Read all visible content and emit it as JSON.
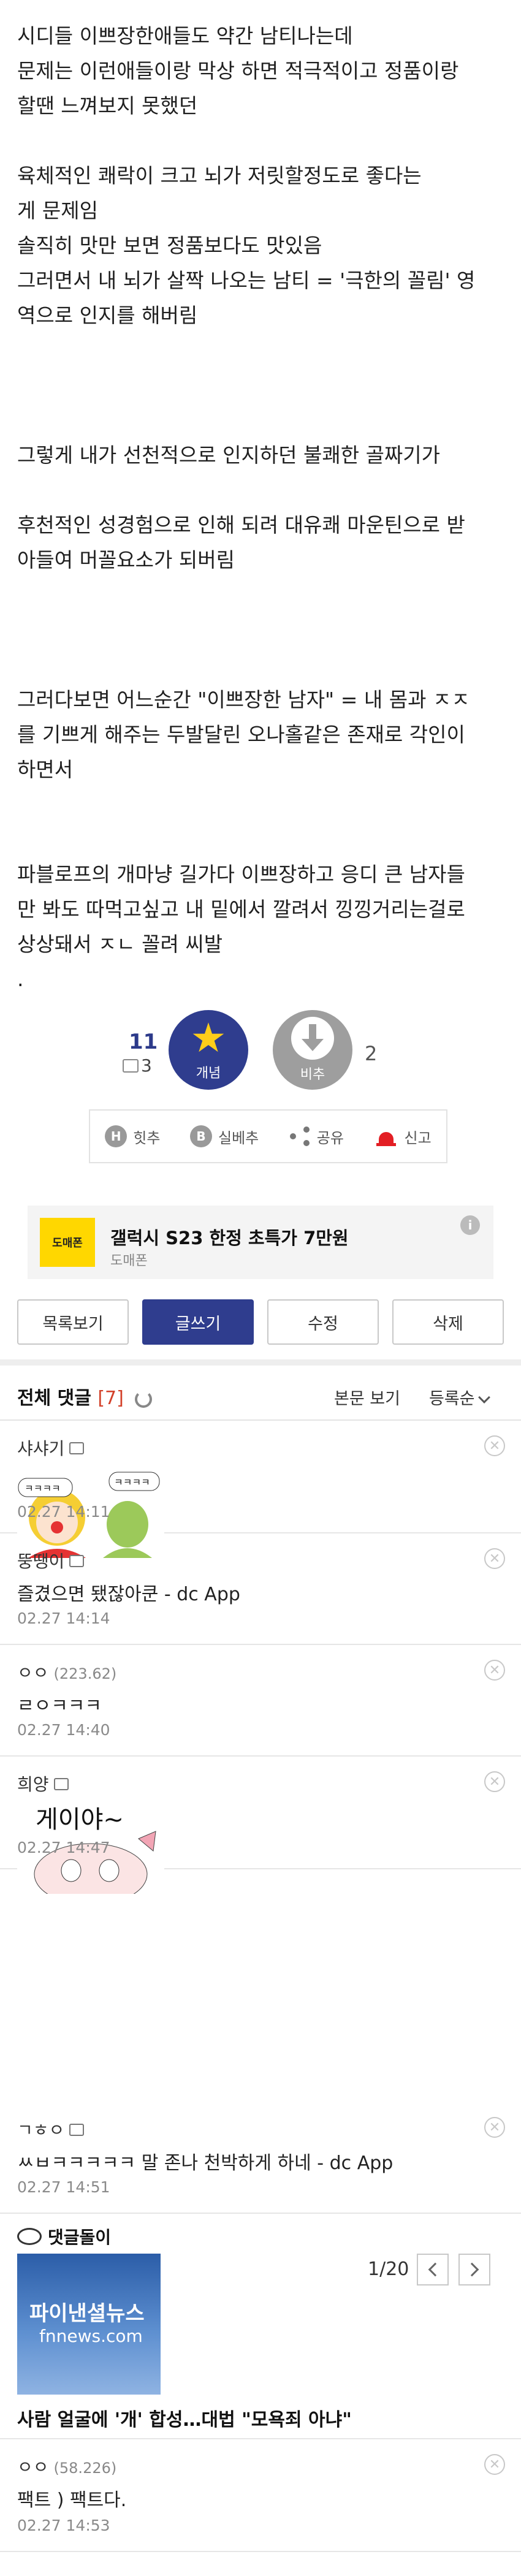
{
  "post": {
    "lines": [
      "시디들 이쁘장한애들도 약간 남티나는데",
      "문제는 이런애들이랑 막상 하면 적극적이고 정품이랑",
      "할땐 느껴보지 못했던",
      "",
      "육체적인 쾌락이 크고 뇌가 저릿할정도로 좋다는",
      "게 문제임",
      "솔직히 맛만 보면 정품보다도 맛있음",
      "그러면서 내 뇌가 살짝 나오는 남티 = '극한의 꼴림' 영",
      "역으로 인지를 해버림",
      "",
      "",
      "",
      "그렇게 내가 선천적으로 인지하던 불쾌한 골짜기가",
      "",
      "후천적인 성경험으로 인해 되려 대유쾌 마운틴으로 받",
      "아들여 머꼴요소가 되버림",
      "",
      "",
      "",
      "그러다보면 어느순간 \"이쁘장한 남자\" = 내 몸과 ㅈㅈ",
      "를 기쁘게 해주는 두발달린 오나홀같은 존재로 각인이",
      "하면서",
      "",
      "",
      "파블로프의 개마냥 길가다 이쁘장하고 응디 큰 남자들",
      "만 봐도 따먹고싶고 내 밑에서 깔려서 낑낑거리는걸로",
      "상상돼서 ㅈㄴ 꼴려 씨발",
      "."
    ]
  },
  "vote": {
    "recommend_count": "11",
    "fixed_recommend_count": "3",
    "recommend_label": "개념",
    "nonrecommend_label": "비추",
    "nonrecommend_count": "2"
  },
  "actions": {
    "hit": "힛추",
    "best": "실베추",
    "share": "공유",
    "report": "신고"
  },
  "ad": {
    "logo": "도매폰",
    "title": "갤럭시 S23 한정 초특가 7만원",
    "subtitle": "도매폰",
    "info": "i"
  },
  "buttons": {
    "list": "목록보기",
    "write": "글쓰기",
    "edit": "수정",
    "delete": "삭제"
  },
  "comments_header": {
    "title": "전체 댓글",
    "count": "[7]",
    "view_body": "본문 보기",
    "sort": "등록순"
  },
  "comments": [
    {
      "name": "샤샤기",
      "ip": "",
      "text": "",
      "date": "02.27 14:11",
      "image": "ㅋㅋㅋㅋ"
    },
    {
      "name": "뚱땡이",
      "ip": "",
      "text": "즐겼으면 됐잖아쿤 - dc App",
      "date": "02.27 14:14"
    },
    {
      "name": "ㅇㅇ",
      "ip": "(223.62)",
      "text": "ㄹㅇㅋㅋㅋ",
      "date": "02.27 14:40"
    },
    {
      "name": "희양",
      "ip": "",
      "text": "",
      "date": "02.27 14:47",
      "image": "게이야~"
    },
    {
      "name": "ㄱㅎㅇ",
      "ip": "",
      "text": "ㅆㅂㅋㅋㅋㅋㅋ 말 존나 천박하게 하네 - dc App",
      "date": "02.27 14:51"
    },
    {
      "name": "ㅇㅇ",
      "ip": "(58.226)",
      "text": "팩트 ) 팩트다.",
      "date": "02.27 14:53"
    }
  ],
  "dccon": {
    "title": "댓글돌이",
    "thumb_title": "파이낸셜뉴스",
    "thumb_sub": "fnnews.com",
    "page": "1/20",
    "headline": "사람 얼굴에 '개' 합성…대법 \"모욕죄 아냐\""
  },
  "colors": {
    "accent": "#2f3d8e",
    "star": "#ffcd1a",
    "count": "#d3412a",
    "report": "#e31e24"
  }
}
